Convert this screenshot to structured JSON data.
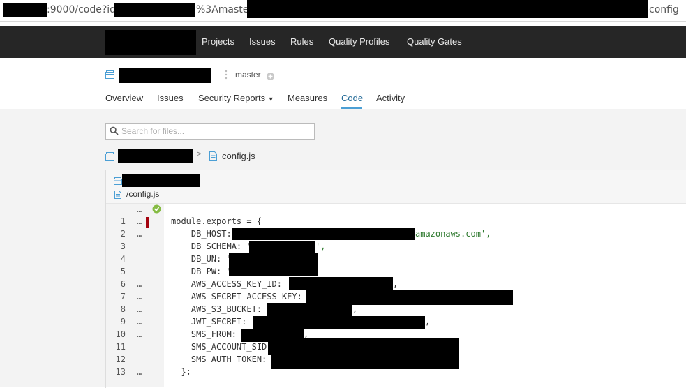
{
  "url_bar": {
    "segment_port_path": ":9000/code?id=",
    "segment_branch": "%3Amaster-",
    "segment_end": "config"
  },
  "top_nav": {
    "items": [
      "Projects",
      "Issues",
      "Rules",
      "Quality Profiles",
      "Quality Gates"
    ]
  },
  "project": {
    "branch": "master"
  },
  "tabs": [
    "Overview",
    "Issues",
    "Security Reports",
    "Measures",
    "Code",
    "Activity"
  ],
  "active_tab": "Code",
  "search": {
    "placeholder": "Search for files..."
  },
  "breadcrumb": {
    "file": "config.js"
  },
  "code_header": {
    "file_path": "/config.js"
  },
  "code": {
    "lines": [
      {
        "n": "1",
        "dots": "…",
        "text": "module.exports = {",
        "tail": ""
      },
      {
        "n": "2",
        "dots": "…",
        "text": "    DB_HOST: ",
        "tail": "amazonaws.com',"
      },
      {
        "n": "3",
        "dots": "",
        "text": "    DB_SCHEMA: '",
        "tail": "',"
      },
      {
        "n": "4",
        "dots": "",
        "text": "    DB_UN: '",
        "tail": ""
      },
      {
        "n": "5",
        "dots": "",
        "text": "    DB_PW: '",
        "tail": ""
      },
      {
        "n": "6",
        "dots": "…",
        "text": "    AWS_ACCESS_KEY_ID: '",
        "tail": ","
      },
      {
        "n": "7",
        "dots": "…",
        "text": "    AWS_SECRET_ACCESS_KEY: '",
        "tail": ""
      },
      {
        "n": "8",
        "dots": "…",
        "text": "    AWS_S3_BUCKET: '",
        "tail": ","
      },
      {
        "n": "9",
        "dots": "…",
        "text": "    JWT_SECRET: \"",
        "tail": ","
      },
      {
        "n": "10",
        "dots": "…",
        "text": "    SMS_FROM: '",
        "tail": ","
      },
      {
        "n": "11",
        "dots": "",
        "text": "    SMS_ACCOUNT_SID: '",
        "tail": ""
      },
      {
        "n": "12",
        "dots": "",
        "text": "    SMS_AUTH_TOKEN: ",
        "tail": ""
      },
      {
        "n": "13",
        "dots": "…",
        "text": "  };",
        "tail": ""
      }
    ]
  },
  "colors": {
    "nav_bg": "#262626",
    "active_tab": "#236a97",
    "issue_marker": "#a4030f",
    "string": "#2f7a2f",
    "coverage_ok": "#85bb43"
  }
}
